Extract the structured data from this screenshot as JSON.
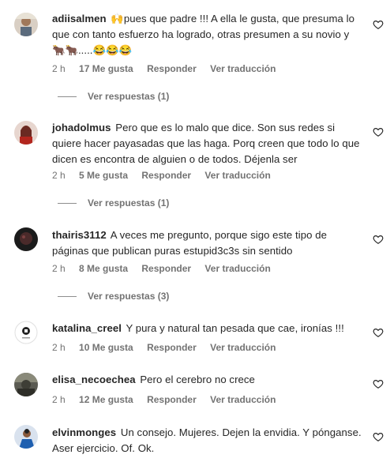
{
  "comments": [
    {
      "username": "adiisalmen",
      "text": "🙌pues que padre !!! A ella le gusta, que presuma lo que con tanto esfuerzo ha logrado, otras presumen a su novio y 🐂🐂.....😂😂😂",
      "time": "2 h",
      "likes": "17 Me gusta",
      "reply": "Responder",
      "translate": "Ver traducción",
      "replies": "Ver respuestas (1)"
    },
    {
      "username": "johadolmus",
      "text": "Pero que es lo malo que dice. Son sus redes si quiere hacer payasadas que las haga. Porq creen que todo lo que dicen es encontra de alguien o de todos. Déjenla ser",
      "time": "2 h",
      "likes": "5 Me gusta",
      "reply": "Responder",
      "translate": "Ver traducción",
      "replies": "Ver respuestas (1)"
    },
    {
      "username": "thairis3112",
      "text": "A veces me pregunto, porque sigo este tipo de páginas que publican puras estupid3c3s sin sentido",
      "time": "2 h",
      "likes": "8 Me gusta",
      "reply": "Responder",
      "translate": "Ver traducción",
      "replies": "Ver respuestas (3)"
    },
    {
      "username": "katalina_creel",
      "text": "Y pura y natural tan pesada que cae, ironías !!!",
      "time": "2 h",
      "likes": "10 Me gusta",
      "reply": "Responder",
      "translate": "Ver traducción"
    },
    {
      "username": "elisa_necoechea",
      "text": "Pero el cerebro no crece",
      "time": "2 h",
      "likes": "12 Me gusta",
      "reply": "Responder",
      "translate": "Ver traducción"
    },
    {
      "username": "elvinmonges",
      "text": "Un consejo. Mujeres. Dejen la envidia. Y pónganse. Aser ejercicio. Of. Ok."
    }
  ],
  "icons": {
    "like": "heart-outline-icon"
  },
  "colors": {
    "text": "#262626",
    "muted": "#737373"
  }
}
